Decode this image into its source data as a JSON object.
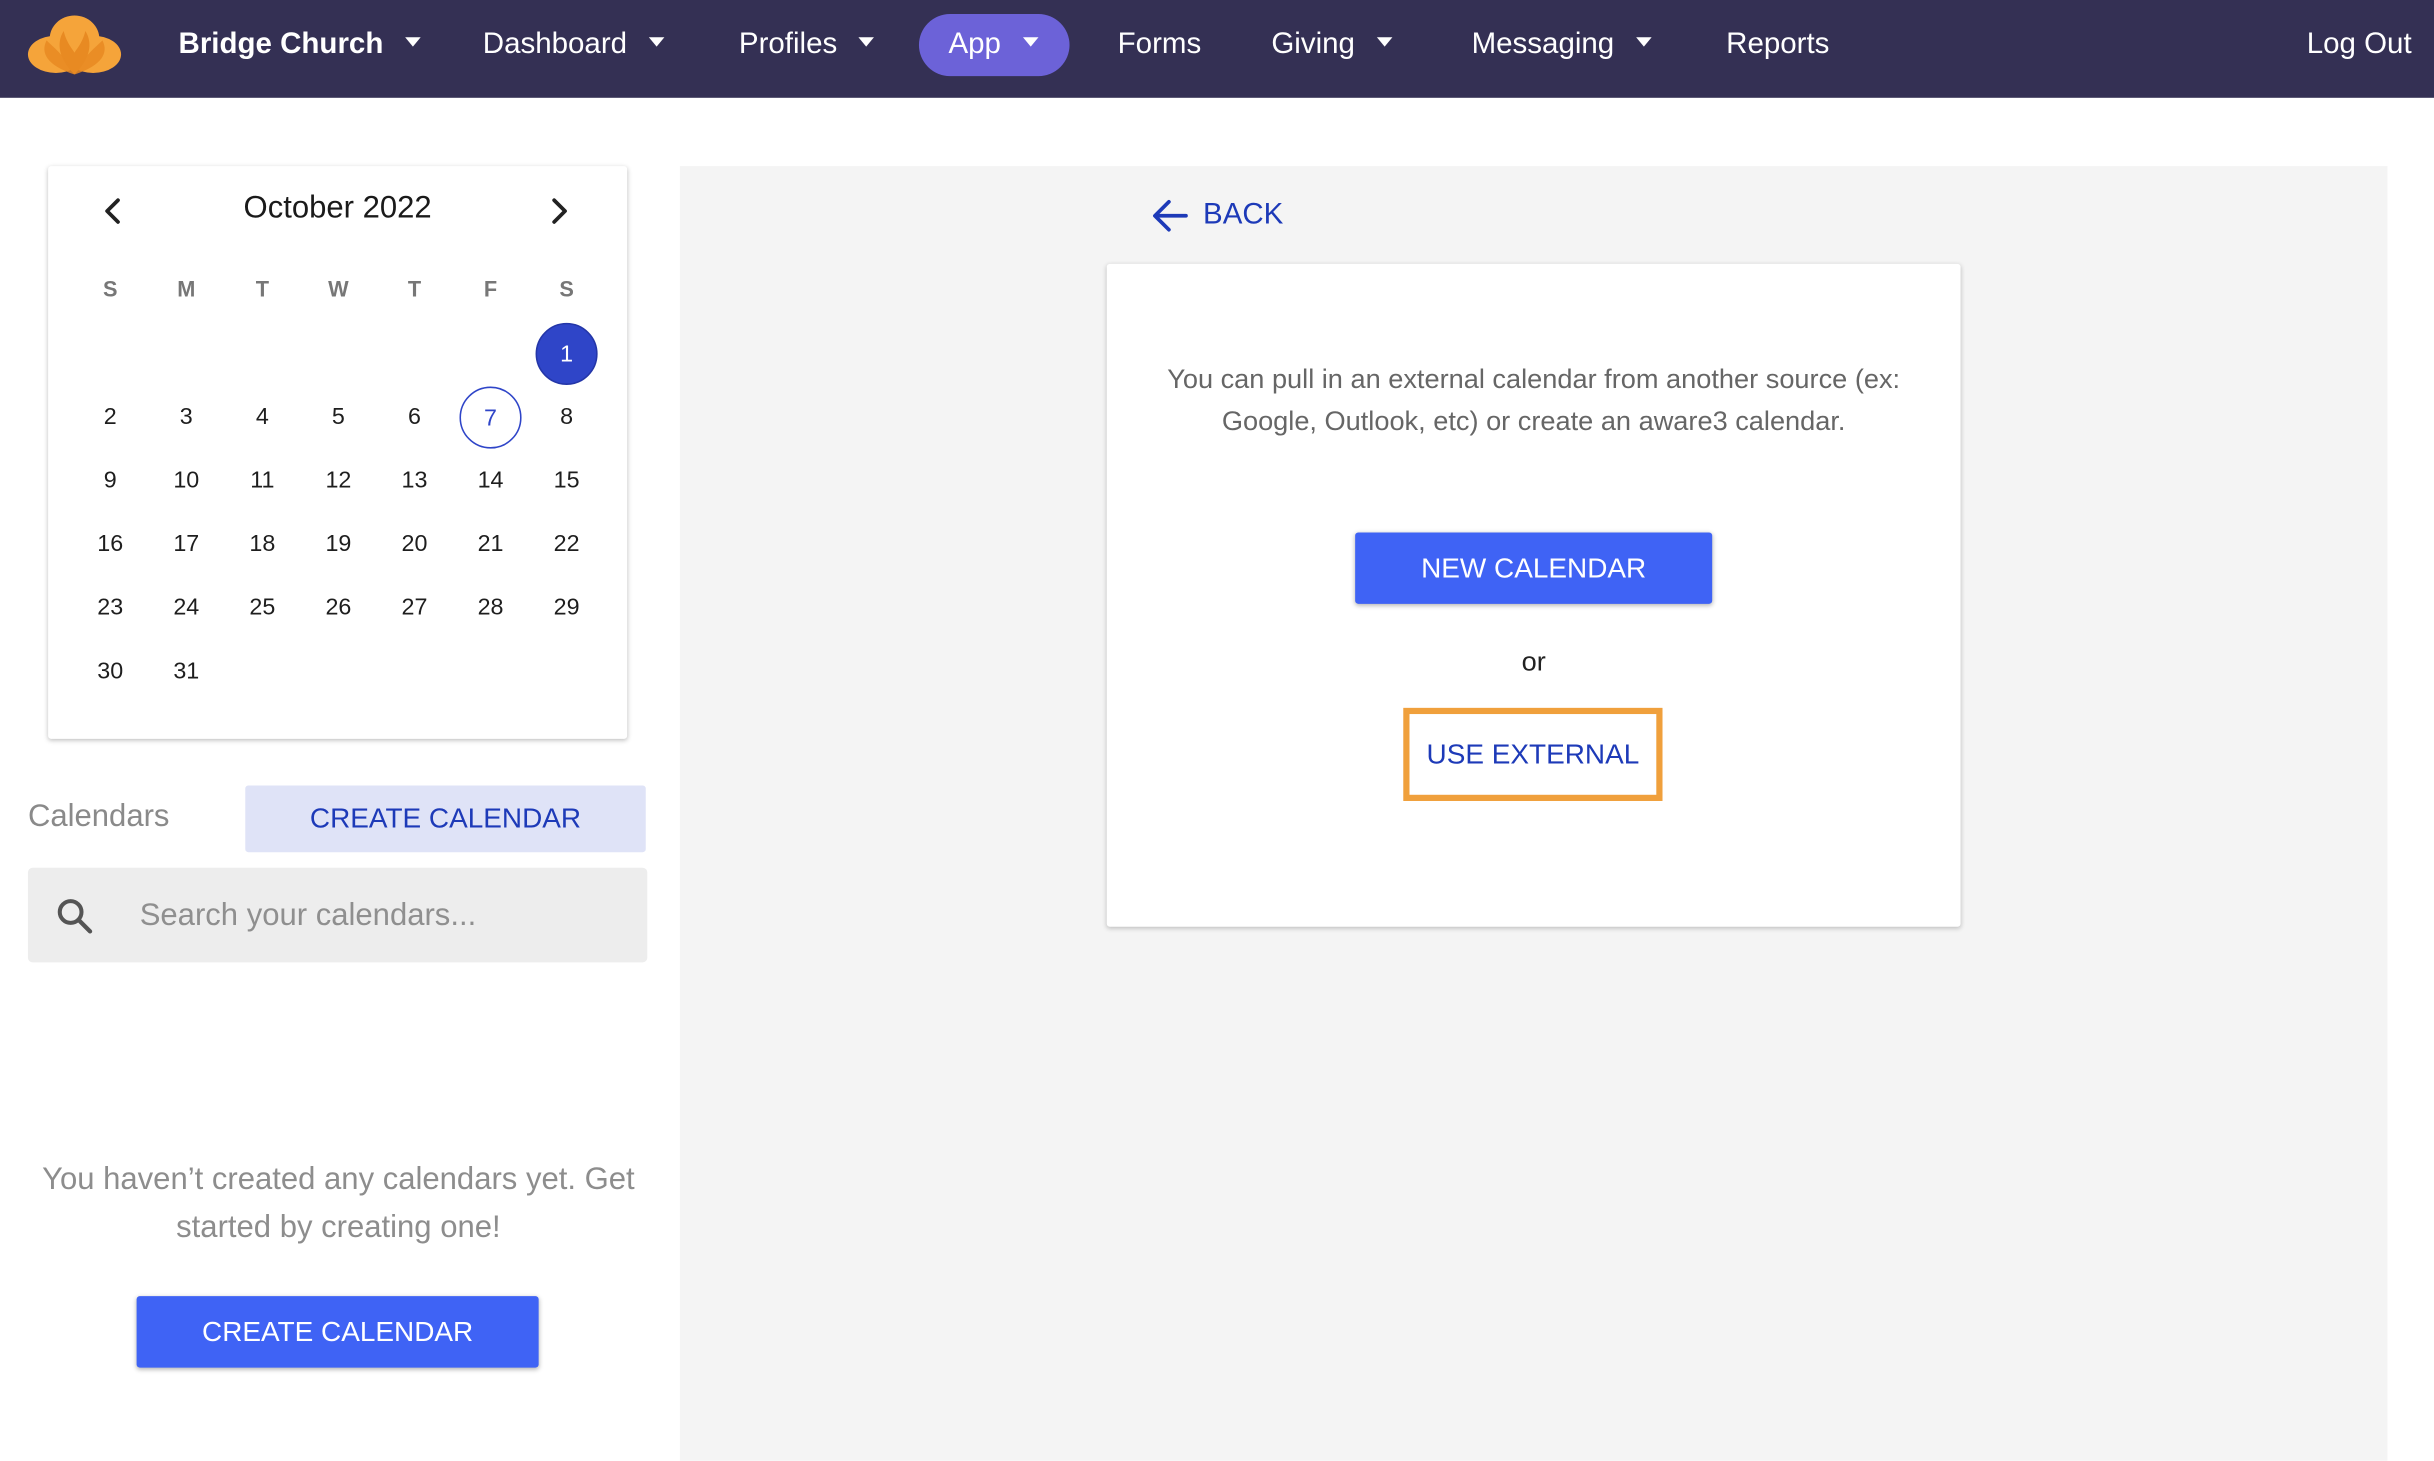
{
  "nav": {
    "org": "Bridge Church",
    "items": [
      "Dashboard",
      "Profiles",
      "App",
      "Forms",
      "Giving",
      "Messaging",
      "Reports"
    ],
    "active": "App",
    "logout": "Log Out"
  },
  "calendar": {
    "month_title": "October 2022",
    "weekdays": [
      "S",
      "M",
      "T",
      "W",
      "T",
      "F",
      "S"
    ],
    "first_weekday_index": 6,
    "days_in_month": 31,
    "selected_day": 1,
    "today_day": 7
  },
  "sidebar": {
    "calendars_label": "Calendars",
    "create_button": "CREATE CALENDAR",
    "search_placeholder": "Search your calendars...",
    "empty_message": "You haven’t created any calendars yet. Get started by creating one!",
    "create_button_bottom": "CREATE CALENDAR"
  },
  "main": {
    "back_label": "BACK",
    "description": "You can pull in an external calendar from another source (ex: Google, Outlook, etc) or create an aware3 calendar.",
    "new_calendar_button": "NEW CALENDAR",
    "or_text": "or",
    "use_external_button": "USE EXTERNAL"
  },
  "colors": {
    "nav_bg": "#343054",
    "nav_active": "#6c62d8",
    "primary": "#3f63f5",
    "link": "#1d3ab8",
    "highlight": "#f0a03c",
    "logo": "#f5a43a"
  },
  "icons": {
    "logo": "church-flame-logo-icon",
    "caret": "chevron-down-icon",
    "prev": "chevron-left-icon",
    "next": "chevron-right-icon",
    "search": "search-icon",
    "back": "arrow-left-icon"
  }
}
